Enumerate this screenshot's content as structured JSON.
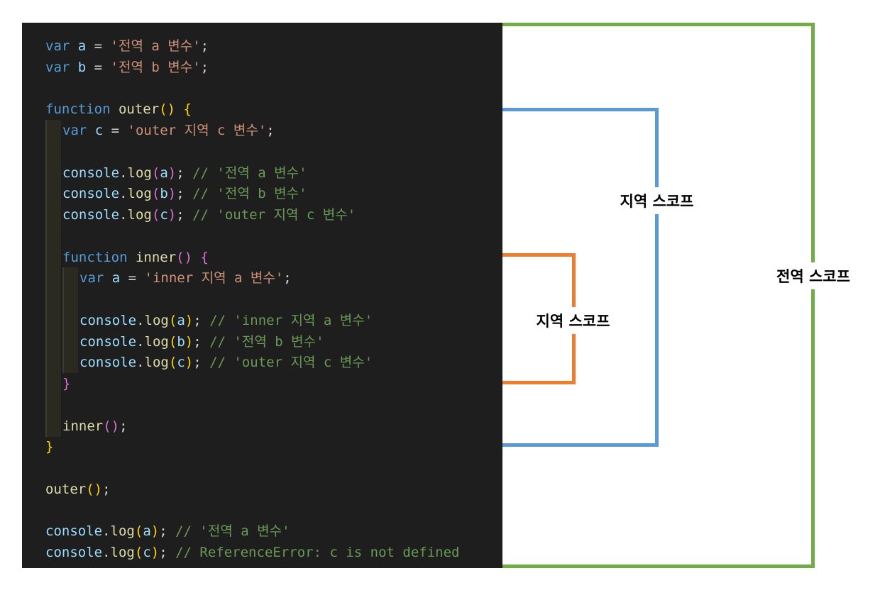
{
  "colors": {
    "background": "#1e1e1e",
    "keyword": "#569cd6",
    "variable": "#9cdcfe",
    "function": "#dcdcaa",
    "string": "#ce9178",
    "comment": "#6a9955",
    "punctuation": "#d4d4d4",
    "bracket_gold": "#ffd700",
    "bracket_pink": "#da70d6",
    "global_scope": "#70ad47",
    "outer_scope": "#5b9bd5",
    "inner_scope": "#ed7d31"
  },
  "code": {
    "lines": [
      {
        "indent": 0,
        "tokens": [
          {
            "t": "var ",
            "c": "keyword"
          },
          {
            "t": "a",
            "c": "variable"
          },
          {
            "t": " = ",
            "c": "punctuation"
          },
          {
            "t": "'전역 a 변수'",
            "c": "string"
          },
          {
            "t": ";",
            "c": "punctuation"
          }
        ]
      },
      {
        "indent": 0,
        "tokens": [
          {
            "t": "var ",
            "c": "keyword"
          },
          {
            "t": "b",
            "c": "variable"
          },
          {
            "t": " = ",
            "c": "punctuation"
          },
          {
            "t": "'전역 b 변수'",
            "c": "string"
          },
          {
            "t": ";",
            "c": "punctuation"
          }
        ]
      },
      {
        "indent": 0,
        "tokens": []
      },
      {
        "indent": 0,
        "tokens": [
          {
            "t": "function ",
            "c": "keyword"
          },
          {
            "t": "outer",
            "c": "function"
          },
          {
            "t": "() ",
            "c": "bracket_gold"
          },
          {
            "t": "{",
            "c": "bracket_gold"
          }
        ]
      },
      {
        "indent": 1,
        "tokens": [
          {
            "t": "var ",
            "c": "keyword"
          },
          {
            "t": "c",
            "c": "variable"
          },
          {
            "t": " = ",
            "c": "punctuation"
          },
          {
            "t": "'outer 지역 c 변수'",
            "c": "string"
          },
          {
            "t": ";",
            "c": "punctuation"
          }
        ]
      },
      {
        "indent": 1,
        "tokens": []
      },
      {
        "indent": 1,
        "tokens": [
          {
            "t": "console",
            "c": "variable"
          },
          {
            "t": ".",
            "c": "punctuation"
          },
          {
            "t": "log",
            "c": "function"
          },
          {
            "t": "(",
            "c": "bracket_pink"
          },
          {
            "t": "a",
            "c": "variable"
          },
          {
            "t": ")",
            "c": "bracket_pink"
          },
          {
            "t": "; ",
            "c": "punctuation"
          },
          {
            "t": "// '전역 a 변수'",
            "c": "comment"
          }
        ]
      },
      {
        "indent": 1,
        "tokens": [
          {
            "t": "console",
            "c": "variable"
          },
          {
            "t": ".",
            "c": "punctuation"
          },
          {
            "t": "log",
            "c": "function"
          },
          {
            "t": "(",
            "c": "bracket_pink"
          },
          {
            "t": "b",
            "c": "variable"
          },
          {
            "t": ")",
            "c": "bracket_pink"
          },
          {
            "t": "; ",
            "c": "punctuation"
          },
          {
            "t": "// '전역 b 변수'",
            "c": "comment"
          }
        ]
      },
      {
        "indent": 1,
        "tokens": [
          {
            "t": "console",
            "c": "variable"
          },
          {
            "t": ".",
            "c": "punctuation"
          },
          {
            "t": "log",
            "c": "function"
          },
          {
            "t": "(",
            "c": "bracket_pink"
          },
          {
            "t": "c",
            "c": "variable"
          },
          {
            "t": ")",
            "c": "bracket_pink"
          },
          {
            "t": "; ",
            "c": "punctuation"
          },
          {
            "t": "// 'outer 지역 c 변수'",
            "c": "comment"
          }
        ]
      },
      {
        "indent": 1,
        "tokens": []
      },
      {
        "indent": 1,
        "tokens": [
          {
            "t": "function ",
            "c": "keyword"
          },
          {
            "t": "inner",
            "c": "function"
          },
          {
            "t": "() ",
            "c": "bracket_pink"
          },
          {
            "t": "{",
            "c": "bracket_pink"
          }
        ]
      },
      {
        "indent": 2,
        "tokens": [
          {
            "t": "var ",
            "c": "keyword"
          },
          {
            "t": "a",
            "c": "variable"
          },
          {
            "t": " = ",
            "c": "punctuation"
          },
          {
            "t": "'inner 지역 a 변수'",
            "c": "string"
          },
          {
            "t": ";",
            "c": "punctuation"
          }
        ]
      },
      {
        "indent": 2,
        "tokens": []
      },
      {
        "indent": 2,
        "tokens": [
          {
            "t": "console",
            "c": "variable"
          },
          {
            "t": ".",
            "c": "punctuation"
          },
          {
            "t": "log",
            "c": "function"
          },
          {
            "t": "(",
            "c": "bracket_gold"
          },
          {
            "t": "a",
            "c": "variable"
          },
          {
            "t": ")",
            "c": "bracket_gold"
          },
          {
            "t": "; ",
            "c": "punctuation"
          },
          {
            "t": "// 'inner 지역 a 변수'",
            "c": "comment"
          }
        ]
      },
      {
        "indent": 2,
        "tokens": [
          {
            "t": "console",
            "c": "variable"
          },
          {
            "t": ".",
            "c": "punctuation"
          },
          {
            "t": "log",
            "c": "function"
          },
          {
            "t": "(",
            "c": "bracket_gold"
          },
          {
            "t": "b",
            "c": "variable"
          },
          {
            "t": ")",
            "c": "bracket_gold"
          },
          {
            "t": "; ",
            "c": "punctuation"
          },
          {
            "t": "// '전역 b 변수'",
            "c": "comment"
          }
        ]
      },
      {
        "indent": 2,
        "tokens": [
          {
            "t": "console",
            "c": "variable"
          },
          {
            "t": ".",
            "c": "punctuation"
          },
          {
            "t": "log",
            "c": "function"
          },
          {
            "t": "(",
            "c": "bracket_gold"
          },
          {
            "t": "c",
            "c": "variable"
          },
          {
            "t": ")",
            "c": "bracket_gold"
          },
          {
            "t": "; ",
            "c": "punctuation"
          },
          {
            "t": "// 'outer 지역 c 변수'",
            "c": "comment"
          }
        ]
      },
      {
        "indent": 1,
        "tokens": [
          {
            "t": "}",
            "c": "bracket_pink"
          }
        ]
      },
      {
        "indent": 1,
        "tokens": []
      },
      {
        "indent": 1,
        "tokens": [
          {
            "t": "inner",
            "c": "function"
          },
          {
            "t": "()",
            "c": "bracket_pink"
          },
          {
            "t": ";",
            "c": "punctuation"
          }
        ]
      },
      {
        "indent": 0,
        "tokens": [
          {
            "t": "}",
            "c": "bracket_gold"
          }
        ]
      },
      {
        "indent": 0,
        "tokens": []
      },
      {
        "indent": 0,
        "tokens": [
          {
            "t": "outer",
            "c": "function"
          },
          {
            "t": "()",
            "c": "bracket_gold"
          },
          {
            "t": ";",
            "c": "punctuation"
          }
        ]
      },
      {
        "indent": 0,
        "tokens": []
      },
      {
        "indent": 0,
        "tokens": [
          {
            "t": "console",
            "c": "variable"
          },
          {
            "t": ".",
            "c": "punctuation"
          },
          {
            "t": "log",
            "c": "function"
          },
          {
            "t": "(",
            "c": "bracket_gold"
          },
          {
            "t": "a",
            "c": "variable"
          },
          {
            "t": ")",
            "c": "bracket_gold"
          },
          {
            "t": "; ",
            "c": "punctuation"
          },
          {
            "t": "// '전역 a 변수'",
            "c": "comment"
          }
        ]
      },
      {
        "indent": 0,
        "tokens": [
          {
            "t": "console",
            "c": "variable"
          },
          {
            "t": ".",
            "c": "punctuation"
          },
          {
            "t": "log",
            "c": "function"
          },
          {
            "t": "(",
            "c": "bracket_gold"
          },
          {
            "t": "c",
            "c": "variable"
          },
          {
            "t": ")",
            "c": "bracket_gold"
          },
          {
            "t": "; ",
            "c": "punctuation"
          },
          {
            "t": "// ReferenceError: c is not defined",
            "c": "comment"
          }
        ]
      }
    ]
  },
  "scopes": {
    "global_label": "전역 스코프",
    "outer_label": "지역 스코프",
    "inner_label": "지역 스코프"
  }
}
